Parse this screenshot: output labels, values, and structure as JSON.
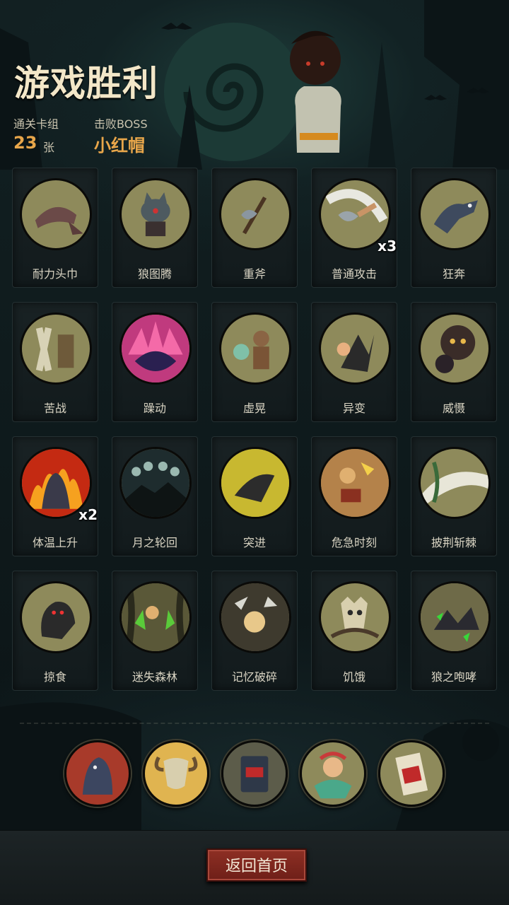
{
  "header": {
    "title": "游戏胜利",
    "deck_label": "通关卡组",
    "deck_count": "23",
    "deck_unit": "张",
    "boss_label": "击败BOSS",
    "boss_name": "小红帽"
  },
  "cards": [
    {
      "name": "耐力头巾",
      "icon": "bandana-icon",
      "multiplier": ""
    },
    {
      "name": "狼图腾",
      "icon": "wolf-totem-icon",
      "multiplier": ""
    },
    {
      "name": "重斧",
      "icon": "heavy-axe-icon",
      "multiplier": ""
    },
    {
      "name": "普通攻击",
      "icon": "axe-swing-icon",
      "multiplier": "x3"
    },
    {
      "name": "狂奔",
      "icon": "running-wolf-icon",
      "multiplier": ""
    },
    {
      "name": "苦战",
      "icon": "shield-warrior-icon",
      "multiplier": ""
    },
    {
      "name": "躁动",
      "icon": "restless-jaws-icon",
      "multiplier": ""
    },
    {
      "name": "虚晃",
      "icon": "boxer-icon",
      "multiplier": ""
    },
    {
      "name": "异变",
      "icon": "mutation-icon",
      "multiplier": ""
    },
    {
      "name": "威慑",
      "icon": "deterrence-icon",
      "multiplier": ""
    },
    {
      "name": "体温上升",
      "icon": "flaming-werewolf-icon",
      "multiplier": "x2"
    },
    {
      "name": "月之轮回",
      "icon": "moon-phases-icon",
      "multiplier": ""
    },
    {
      "name": "突进",
      "icon": "lunge-icon",
      "multiplier": ""
    },
    {
      "name": "危急时刻",
      "icon": "crisis-icon",
      "multiplier": ""
    },
    {
      "name": "披荆斩棘",
      "icon": "thorn-slash-icon",
      "multiplier": ""
    },
    {
      "name": "掠食",
      "icon": "predator-icon",
      "multiplier": ""
    },
    {
      "name": "迷失森林",
      "icon": "lost-forest-icon",
      "multiplier": ""
    },
    {
      "name": "记忆破碎",
      "icon": "shattered-memory-icon",
      "multiplier": ""
    },
    {
      "name": "饥饿",
      "icon": "hunger-skull-icon",
      "multiplier": ""
    },
    {
      "name": "狼之咆哮",
      "icon": "wolf-howl-icon",
      "multiplier": ""
    }
  ],
  "relics": [
    {
      "icon": "werewolf-relic-icon"
    },
    {
      "icon": "ram-skull-relic-icon"
    },
    {
      "icon": "red-book-relic-icon"
    },
    {
      "icon": "forest-spirit-relic-icon"
    },
    {
      "icon": "tarot-card-relic-icon"
    }
  ],
  "footer": {
    "back_label": "返回首页"
  },
  "colors": {
    "accent": "#e8a64a",
    "title": "#f3e7c8",
    "card_disk": "#8e8a5b",
    "button": "#7e2a20"
  }
}
